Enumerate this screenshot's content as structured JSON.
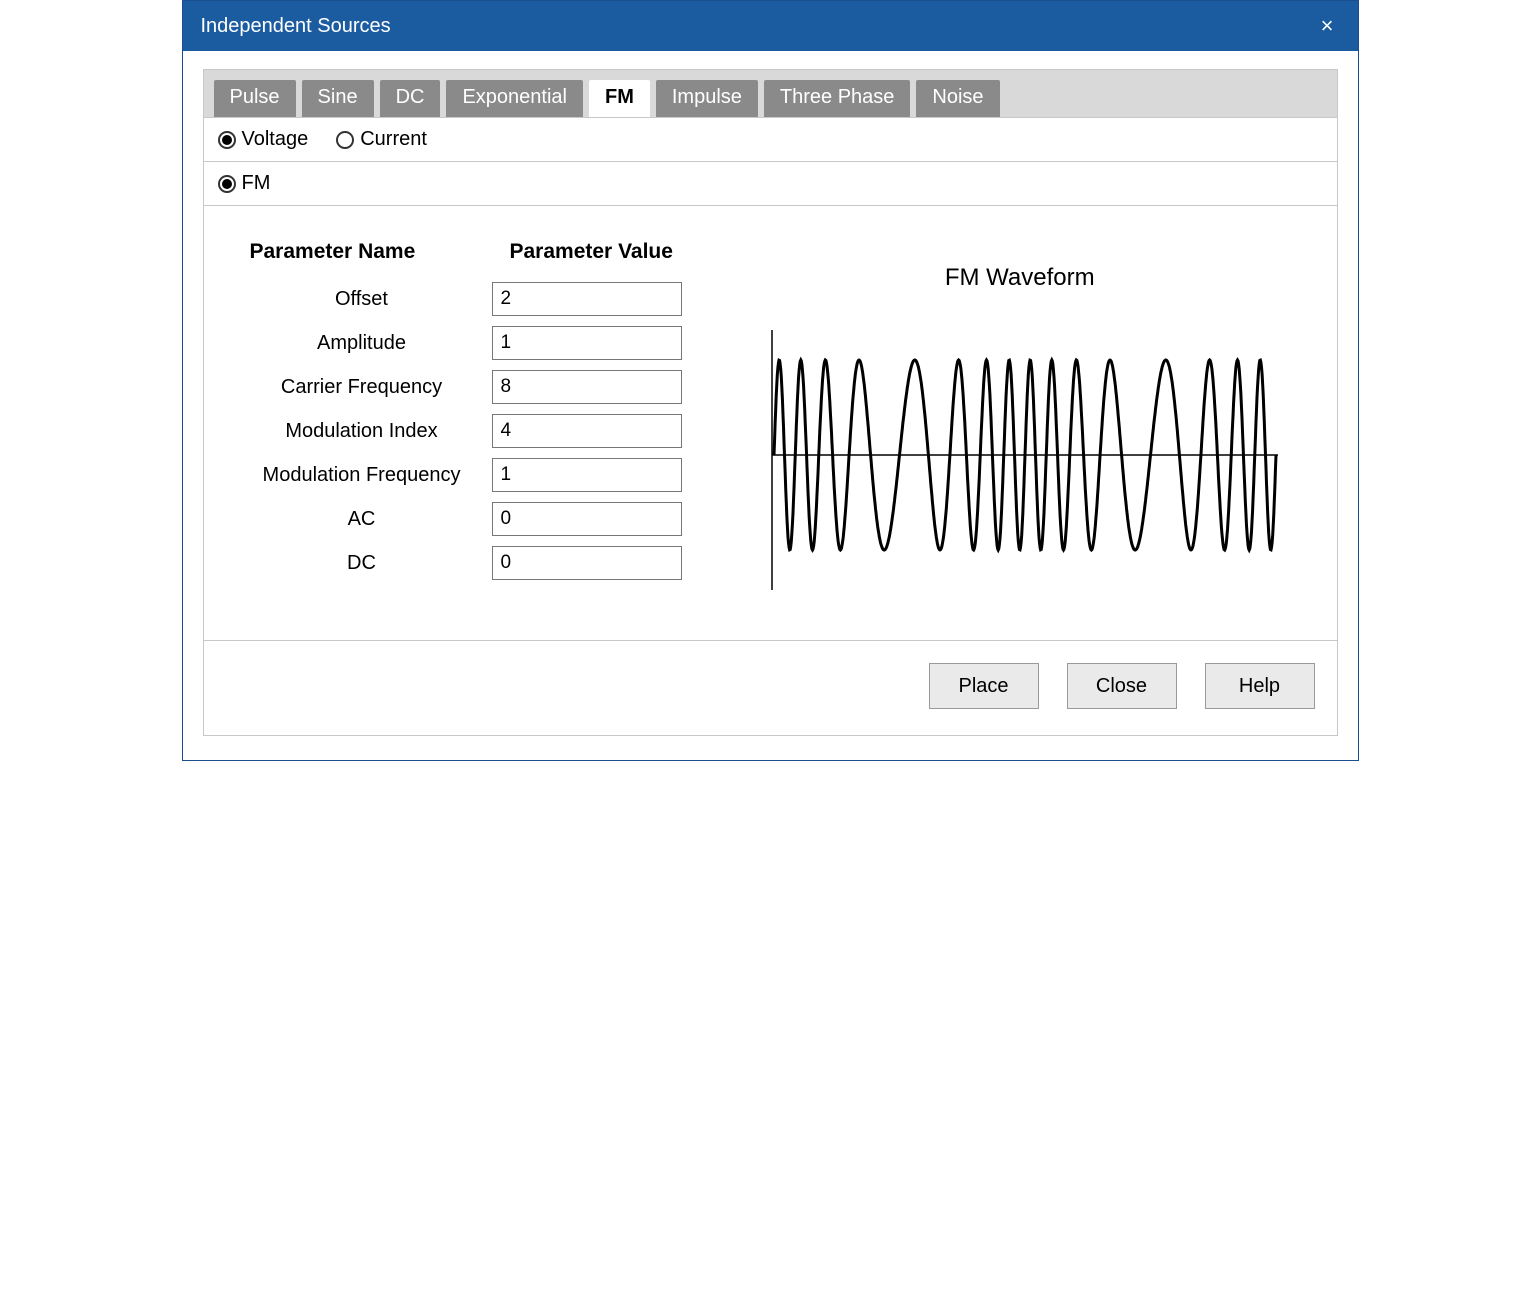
{
  "window": {
    "title": "Independent Sources"
  },
  "tabs": [
    {
      "label": "Pulse",
      "active": false
    },
    {
      "label": "Sine",
      "active": false
    },
    {
      "label": "DC",
      "active": false
    },
    {
      "label": "Exponential",
      "active": false
    },
    {
      "label": "FM",
      "active": true
    },
    {
      "label": "Impulse",
      "active": false
    },
    {
      "label": "Three Phase",
      "active": false
    },
    {
      "label": "Noise",
      "active": false
    }
  ],
  "source_type": {
    "voltage_label": "Voltage",
    "current_label": "Current",
    "selected": "voltage"
  },
  "waveform_mode": {
    "fm_label": "FM",
    "selected": "fm"
  },
  "param_headers": {
    "name": "Parameter Name",
    "value": "Parameter Value"
  },
  "parameters": [
    {
      "name": "Offset",
      "value": "2"
    },
    {
      "name": "Amplitude",
      "value": "1"
    },
    {
      "name": "Carrier Frequency",
      "value": "8"
    },
    {
      "name": "Modulation Index",
      "value": "4"
    },
    {
      "name": "Modulation Frequency",
      "value": "1"
    },
    {
      "name": "AC",
      "value": "0"
    },
    {
      "name": "DC",
      "value": "0"
    }
  ],
  "waveform_preview": {
    "title": "FM Waveform"
  },
  "buttons": {
    "place": "Place",
    "close": "Close",
    "help": "Help"
  }
}
